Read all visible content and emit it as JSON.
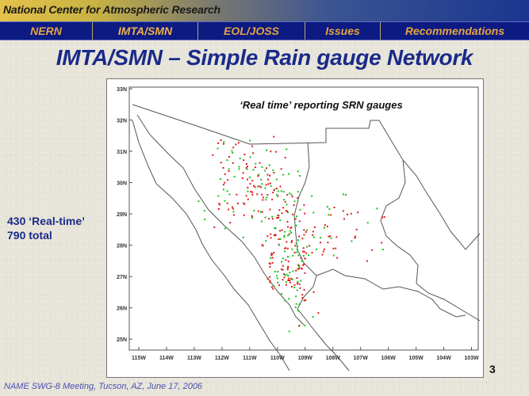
{
  "header": {
    "org_title": "National Center for Atmospheric Research"
  },
  "nav": {
    "items": [
      {
        "label": "NERN",
        "active": false
      },
      {
        "label": "IMTA/SMN",
        "active": true
      },
      {
        "label": "EOL/JOSS",
        "active": false
      },
      {
        "label": "Issues",
        "active": false
      },
      {
        "label": "Recommendations",
        "active": false
      }
    ]
  },
  "slide": {
    "title": "IMTA/SMN – Simple Rain gauge Network",
    "note_line1": "430 ‘Real-time’",
    "note_line2": "790 total",
    "page_number": "3",
    "footer": "NAME SWG-8 Meeting, Tucson, AZ, June 17, 2006"
  },
  "map": {
    "caption": "‘Real time’ reporting SRN gauges",
    "lat_labels": [
      "33N",
      "32N",
      "31N",
      "30N",
      "29N",
      "28N",
      "27N",
      "26N",
      "25N"
    ],
    "lon_labels": [
      "115W",
      "114W",
      "113W",
      "112W",
      "111W",
      "110W",
      "109W",
      "108W",
      "107W",
      "106W",
      "105W",
      "104W",
      "103W"
    ],
    "colors": {
      "realtime": "#e11b1b",
      "other": "#18c21b"
    }
  }
}
